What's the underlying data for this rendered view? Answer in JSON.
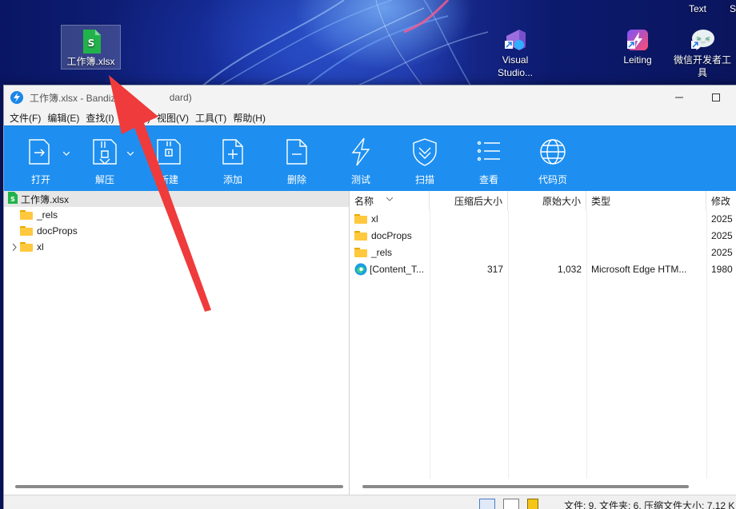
{
  "desktop": {
    "corner_text": "Text",
    "corner_text2": "S",
    "icons": [
      {
        "label": "工作簿.xlsx",
        "icon": "spreadsheet-file-icon"
      },
      {
        "label": "Visual Studio...",
        "label_line1": "Visual",
        "label_line2": "Studio...",
        "icon": "visual-studio-icon"
      },
      {
        "label": "Leiting",
        "icon": "leiting-icon"
      },
      {
        "label": "微信开发者工具",
        "label_line1": "微信开发者工",
        "label_line2": "具",
        "icon": "wechat-devtools-icon"
      }
    ]
  },
  "window": {
    "title": "工作簿.xlsx - Bandizip (Standard)",
    "title_visible": "工作簿.xlsx - Bandizip",
    "title_tail": "dard)",
    "minimize": "—",
    "maximize": "☐"
  },
  "menu": [
    "文件(F)",
    "编辑(E)",
    "查找(I)",
    "选项(O)",
    "视图(V)",
    "工具(T)",
    "帮助(H)"
  ],
  "menu_visible": {
    "find": "查找(I)",
    "options_tail": "项(O)"
  },
  "toolbar": [
    {
      "label": "打开",
      "icon": "open-icon"
    },
    {
      "label": "解压",
      "icon": "extract-icon"
    },
    {
      "label": "新建",
      "icon": "new-archive-icon"
    },
    {
      "label": "添加",
      "icon": "add-file-icon"
    },
    {
      "label": "删除",
      "icon": "delete-file-icon"
    },
    {
      "label": "测试",
      "icon": "test-icon"
    },
    {
      "label": "扫描",
      "icon": "scan-shield-icon"
    },
    {
      "label": "查看",
      "icon": "view-list-icon"
    },
    {
      "label": "代码页",
      "icon": "codepage-globe-icon"
    }
  ],
  "tree": {
    "root": "工作簿.xlsx",
    "items": [
      "_rels",
      "docProps",
      "xl"
    ]
  },
  "list": {
    "columns": [
      "名称",
      "压缩后大小",
      "原始大小",
      "类型",
      "修改"
    ],
    "rows": [
      {
        "name": "xl",
        "compressed": "",
        "original": "",
        "type": "",
        "modified": "2025"
      },
      {
        "name": "docProps",
        "compressed": "",
        "original": "",
        "type": "",
        "modified": "2025"
      },
      {
        "name": "_rels",
        "compressed": "",
        "original": "",
        "type": "",
        "modified": "2025"
      },
      {
        "name": "[Content_T...",
        "compressed": "317",
        "original": "1,032",
        "type": "Microsoft Edge HTM...",
        "modified": "1980"
      }
    ]
  },
  "status": {
    "text": "文件: 9, 文件夹: 6, 压缩文件大小: 7.12 K"
  },
  "colors": {
    "toolbar_blue": "#1e8ff0",
    "annotation_red": "#ef3b3b",
    "folder_yellow": "#ffc83d"
  }
}
